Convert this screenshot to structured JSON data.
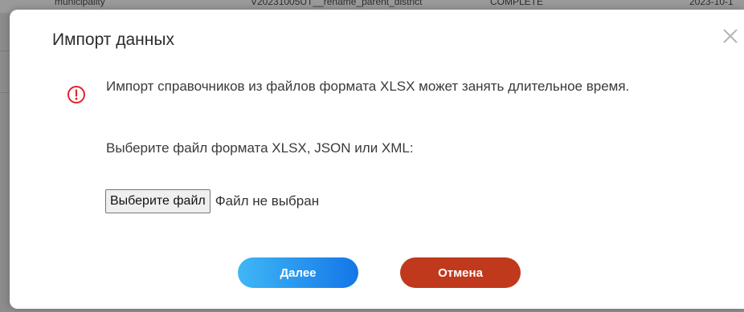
{
  "background": {
    "row": {
      "col1": "municipality",
      "col2": "V20231005UT__rename_parent_district",
      "col3": "COMPLETE",
      "col4": "2023-10-1"
    }
  },
  "dialog": {
    "title": "Импорт данных",
    "warning_text": "Импорт справочников из файлов формата XLSX может занять длительное время.",
    "instruction": "Выберите файл формата XLSX, JSON или XML:",
    "file_button_label": "Выберите файл",
    "file_status": "Файл не выбран",
    "next_label": "Далее",
    "cancel_label": "Отмена"
  },
  "colors": {
    "warning": "#e2232b",
    "next_gradient_start": "#3fb7f6",
    "next_gradient_end": "#1476e8",
    "cancel": "#c0391d"
  },
  "icons": {
    "warning": "exclamation-circle-icon",
    "close": "close-icon"
  }
}
